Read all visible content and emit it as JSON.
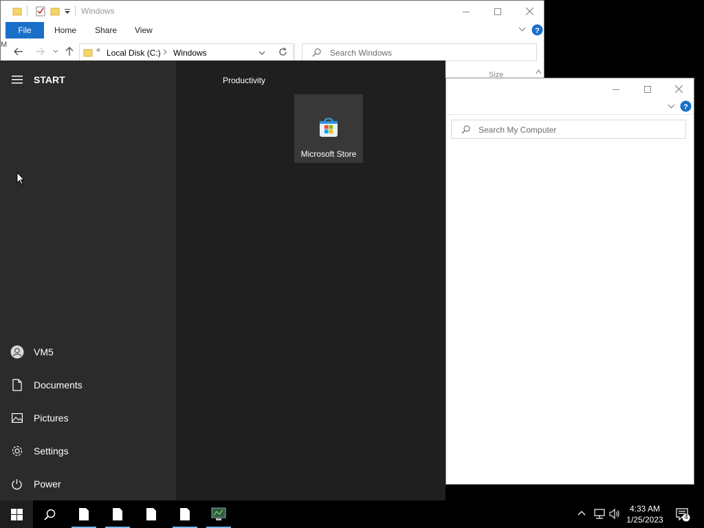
{
  "explorer_back": {
    "title": "Windows",
    "ribbon_tabs": [
      "File",
      "Home",
      "Share",
      "View"
    ],
    "address": {
      "segments": [
        "Local Disk (C:)",
        "Windows"
      ]
    },
    "search_placeholder": "Search Windows",
    "column_header": "Size",
    "stray_char": "M"
  },
  "explorer_front": {
    "search_placeholder": "Search My Computer"
  },
  "start_menu": {
    "title": "START",
    "group_title": "Productivity",
    "tile_label": "Microsoft Store",
    "items": [
      {
        "label": "VM5",
        "icon": "user-icon"
      },
      {
        "label": "Documents",
        "icon": "document-icon"
      },
      {
        "label": "Pictures",
        "icon": "pictures-icon"
      },
      {
        "label": "Settings",
        "icon": "gear-icon"
      },
      {
        "label": "Power",
        "icon": "power-icon"
      }
    ]
  },
  "taskbar": {
    "time": "4:33 AM",
    "date": "1/25/2023",
    "notification_count": "4"
  },
  "colors": {
    "accent": "#1a6fc9",
    "start_left": "#2b2b2b",
    "start_right": "#1f1f1f",
    "tile": "#383838",
    "taskbar_underline": "#76b9ed"
  }
}
